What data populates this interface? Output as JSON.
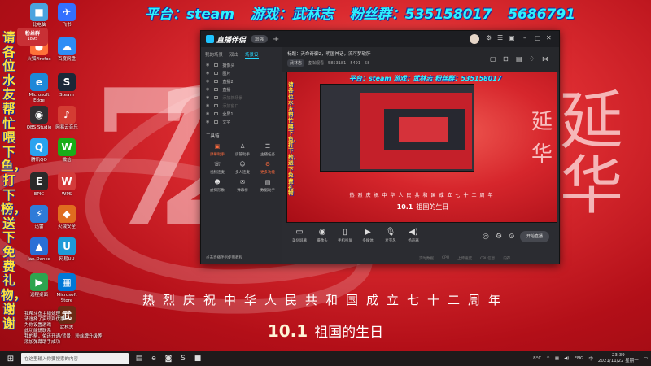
{
  "overlay": {
    "top_banner": [
      "平台：steam",
      "游戏：武林志",
      "粉丝群：535158017",
      "5686791"
    ],
    "left_banner": "请各位水友帮忙喂下鱼，打下榜，送下免费礼物，谢谢"
  },
  "fan_bubble": {
    "title": "粉丝群",
    "number": "1895"
  },
  "desktop_icons": [
    {
      "label": "此电脑",
      "glyph": "■",
      "color": "#4aa3df"
    },
    {
      "label": "飞书",
      "glyph": "✈",
      "color": "#3370ff"
    },
    {
      "label": "火狐Firefox",
      "glyph": "●",
      "color": "#ff7139"
    },
    {
      "label": "百度网盘",
      "glyph": "☁",
      "color": "#2e8df5"
    },
    {
      "label": "Microsoft Edge",
      "glyph": "e",
      "color": "#1e88d8"
    },
    {
      "label": "Steam",
      "glyph": "S",
      "color": "#1b2838"
    },
    {
      "label": "OBS Studio",
      "glyph": "◉",
      "color": "#302e31"
    },
    {
      "label": "网易云音乐",
      "glyph": "♪",
      "color": "#d43c33"
    },
    {
      "label": "腾讯QQ",
      "glyph": "Q",
      "color": "#2aa3ef"
    },
    {
      "label": "微信",
      "glyph": "W",
      "color": "#1aad19"
    },
    {
      "label": "EPIC",
      "glyph": "E",
      "color": "#2a2a2a"
    },
    {
      "label": "WPS",
      "glyph": "W",
      "color": "#d43b3b"
    },
    {
      "label": "迅雷",
      "glyph": "⚡",
      "color": "#2f7bd8"
    },
    {
      "label": "火绒安全",
      "glyph": "◆",
      "color": "#e06c1f"
    },
    {
      "label": "Jan Dance",
      "glyph": "▲",
      "color": "#2a6fd6"
    },
    {
      "label": "网易UU",
      "glyph": "U",
      "color": "#1e9ad8"
    },
    {
      "label": "远程桌面",
      "glyph": "▶",
      "color": "#2ea44f"
    },
    {
      "label": "Microsoft Store",
      "glyph": "▦",
      "color": "#0078d7"
    },
    {
      "label": "武林志",
      "glyph": "武",
      "color": "#6b2b16"
    }
  ],
  "desktop_notice": "我帮斗鱼主播处理 \n请选择了实现到优惠 \n为你设置游戏 \n此功能请联系 \n我的帮，佑还开通/背景，粉丝牌升级等 \n添加弹幕助手成功",
  "wallpaper": {
    "celebrate": "热烈庆祝中华人民共和国成立七十二周年",
    "birthday_num": "10.1",
    "birthday_text": "祖国的生日",
    "chars": [
      "延",
      "华"
    ]
  },
  "app": {
    "name": "直播伴侣",
    "version": "增强",
    "tabs": [
      "我的场景",
      "双击",
      "场景设"
    ],
    "scenes": [
      "摄像头",
      "图片",
      "直播2",
      "直播",
      "添加新场景",
      "添加窗口",
      "全屏1",
      "文字"
    ],
    "tools_title": "工具箱",
    "tools": [
      {
        "label": "弹幕助手",
        "glyph": "▣",
        "hl": true
      },
      {
        "label": "房管助手",
        "glyph": "♙",
        "hl": false
      },
      {
        "label": "主播任务",
        "glyph": "☰",
        "hl": false
      },
      {
        "label": "视频连麦",
        "glyph": "☏",
        "hl": false
      },
      {
        "label": "多人连麦",
        "glyph": "☺",
        "hl": false
      },
      {
        "label": "更多功能",
        "glyph": "⚙",
        "hl": true
      },
      {
        "label": "虚拟形象",
        "glyph": "☻",
        "hl": false
      },
      {
        "label": "弹幕榜",
        "glyph": "✉",
        "hl": false
      },
      {
        "label": "数据助手",
        "glyph": "▤",
        "hl": false
      }
    ],
    "tip": "点击直播伴侣使用教程",
    "stream_title": "标题：天命奇御2，明国神话，流可梦软肝",
    "stream_meta": {
      "category": "武林志",
      "room": "虚拟观看",
      "id": "5853181",
      "viewers": "5491",
      "fans": "58"
    },
    "preview": {
      "banner": "平台：steam  游戏：武林志  粉丝群：535158017",
      "left": "请各位水友帮忙喂下鱼，打下榜，送下免费礼物",
      "celebrate": "热烈庆祝中华人民共和国成立七十二周年",
      "birthday_num": "10.1",
      "birthday_text": "祖国的生日"
    },
    "controls": [
      {
        "label": "美化屏幕",
        "glyph": "▭"
      },
      {
        "label": "摄像头",
        "glyph": "◉"
      },
      {
        "label": "手机投屏",
        "glyph": "▯"
      },
      {
        "label": "多媒体",
        "glyph": "▶"
      },
      {
        "label": "麦克风",
        "glyph": "🎙"
      },
      {
        "label": "扬声器",
        "glyph": "◀)"
      }
    ],
    "go_live": "开始直播",
    "status": [
      "实时数据",
      "CPU",
      "上传速度",
      "CPU信息",
      "内存"
    ]
  },
  "taskbar": {
    "search_placeholder": "在这里输入你要搜索的内容",
    "apps": [
      "▤",
      "e",
      "◙",
      "S",
      "■"
    ],
    "temperature": "8°C",
    "lang": "ENG",
    "ime": "中",
    "time": "23:39",
    "date": "2021/11/22 星期一"
  }
}
